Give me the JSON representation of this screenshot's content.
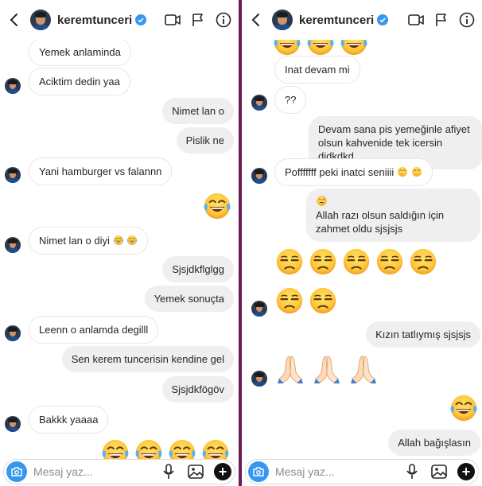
{
  "header": {
    "username": "keremtunceri"
  },
  "composer": {
    "placeholder": "Mesaj yaz..."
  },
  "left": {
    "messages": [
      {
        "dir": "in",
        "text": "Yemek anlaminda"
      },
      {
        "dir": "in",
        "text": "Aciktim dedin yaa"
      },
      {
        "dir": "out",
        "text": "Nimet lan o"
      },
      {
        "dir": "out",
        "text": "Pislik ne"
      },
      {
        "dir": "in",
        "text": "Yani hamburger vs falannn"
      },
      {
        "dir": "in",
        "text": "Nimet lan o diyi"
      },
      {
        "dir": "out",
        "text": "Sjsjdkflglgg"
      },
      {
        "dir": "out",
        "text": "Yemek sonuçta"
      },
      {
        "dir": "in",
        "text": "Leenn o anlamda degilll"
      },
      {
        "dir": "out",
        "text": "Sen kerem tuncerisin kendine gel"
      },
      {
        "dir": "out",
        "text": "Sjsjdkfögöv"
      },
      {
        "dir": "in",
        "text": "Bakkk yaaaa"
      }
    ]
  },
  "right": {
    "messages": [
      {
        "dir": "in",
        "text": "Inat devam mi"
      },
      {
        "dir": "in",
        "text": "??"
      },
      {
        "dir": "out",
        "text": "Devam  sana pis yemeğinle afiyet olsun kahvenide tek icersin djdkdkd"
      },
      {
        "dir": "in",
        "text": "Pofffffff peki inatci seniiii"
      },
      {
        "dir": "in",
        "text": "Allah razı olsun saldığın için zahmet oldu sjsjsjs"
      },
      {
        "dir": "out",
        "text": "Kızın tatlıymış sjsjsjs"
      },
      {
        "dir": "out",
        "text": "Allah bağışlasın"
      }
    ]
  },
  "icons": [
    "back-arrow",
    "video-camera",
    "flag",
    "info",
    "camera",
    "microphone",
    "gallery",
    "plus",
    "verified-badge"
  ],
  "emoji": [
    "face-with-tears-of-joy",
    "unamused-face",
    "hugging-face-covering-mouth",
    "folded-hands",
    "sweat-smile"
  ],
  "colors": {
    "accent": "#3797f0",
    "divider": "#6b1a52",
    "bubble_out": "#efefef"
  }
}
